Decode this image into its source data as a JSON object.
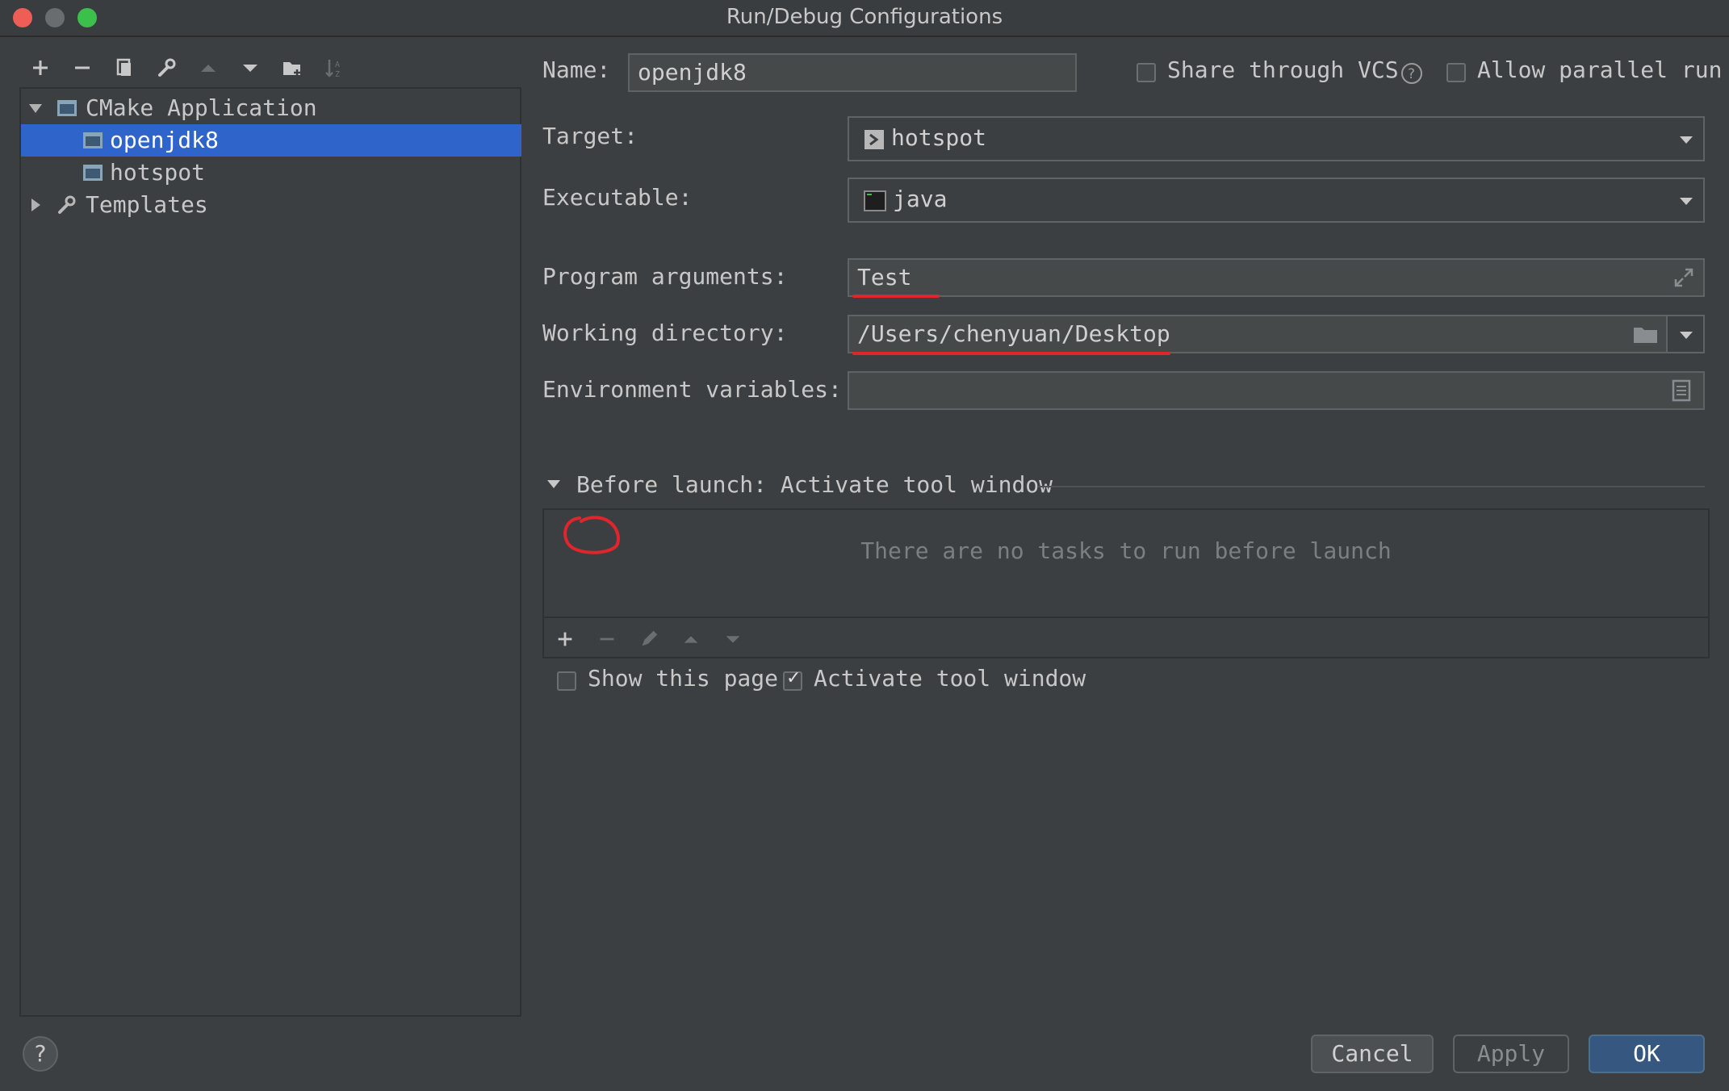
{
  "window": {
    "title": "Run/Debug Configurations"
  },
  "tree": {
    "root_label": "CMake Application",
    "items": [
      {
        "label": "openjdk8",
        "selected": true
      },
      {
        "label": "hotspot",
        "selected": false
      }
    ],
    "templates_label": "Templates"
  },
  "form": {
    "name_label": "Name:",
    "name_value": "openjdk8",
    "share_vcs_label": "Share through VCS",
    "share_vcs_checked": false,
    "allow_parallel_label": "Allow parallel run",
    "allow_parallel_checked": false,
    "target_label": "Target:",
    "target_value": "hotspot",
    "executable_label": "Executable:",
    "executable_value": "java",
    "program_args_label": "Program arguments:",
    "program_args_value": "Test",
    "working_dir_label": "Working directory:",
    "working_dir_value": "/Users/chenyuan/Desktop",
    "env_vars_label": "Environment variables:",
    "env_vars_value": ""
  },
  "before_launch": {
    "header": "Before launch: Activate tool window",
    "empty_text": "There are no tasks to run before launch",
    "show_page_label": "Show this page",
    "show_page_checked": false,
    "activate_window_label": "Activate tool window",
    "activate_window_checked": true
  },
  "buttons": {
    "cancel": "Cancel",
    "apply": "Apply",
    "ok": "OK",
    "help": "?"
  },
  "colors": {
    "selection": "#2f65ca",
    "annotation_red": "#e0262c",
    "primary_button": "#365880"
  }
}
